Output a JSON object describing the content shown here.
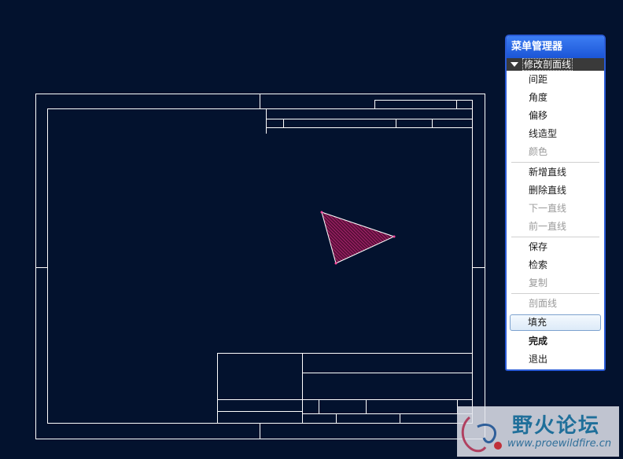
{
  "menu": {
    "title": "菜单管理器",
    "section": "修改剖面线",
    "items": [
      {
        "label": "间距",
        "enabled": true
      },
      {
        "label": "角度",
        "enabled": true
      },
      {
        "label": "偏移",
        "enabled": true
      },
      {
        "label": "线造型",
        "enabled": true
      },
      {
        "label": "颜色",
        "enabled": false
      },
      {
        "label": "新增直线",
        "enabled": true
      },
      {
        "label": "删除直线",
        "enabled": true
      },
      {
        "label": "下一直线",
        "enabled": false
      },
      {
        "label": "前一直线",
        "enabled": false
      },
      {
        "label": "保存",
        "enabled": true
      },
      {
        "label": "检索",
        "enabled": true
      },
      {
        "label": "复制",
        "enabled": false
      },
      {
        "label": "剖面线",
        "enabled": false
      },
      {
        "label": "填充",
        "enabled": true,
        "highlighted": true
      },
      {
        "label": "完成",
        "enabled": true,
        "bold": true
      },
      {
        "label": "退出",
        "enabled": true
      }
    ]
  },
  "watermark": {
    "title": "野火论坛",
    "url": "www.proewildfire.cn"
  },
  "colors": {
    "background": "#03122e",
    "drawing_lines": "#ffffff",
    "hatch": "#d9318a",
    "menu_title": "#1b55d6"
  }
}
